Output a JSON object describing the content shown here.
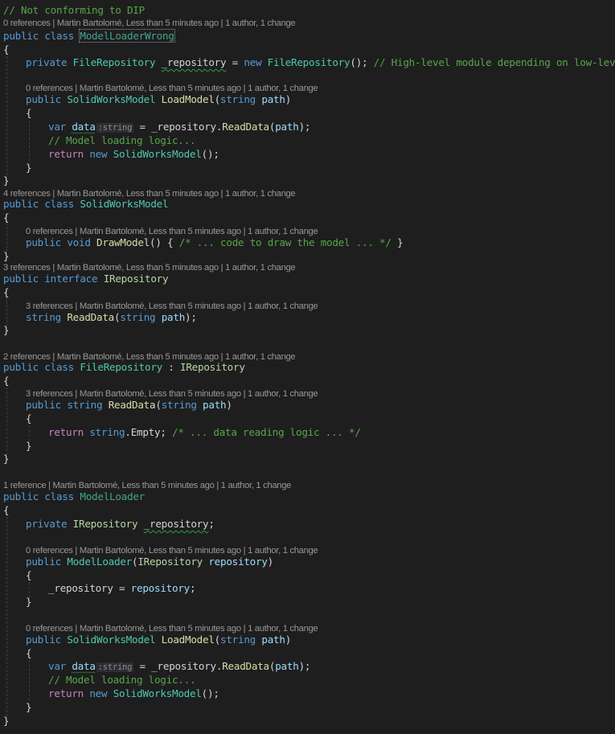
{
  "editor": {
    "comment_header": "// Not conforming to DIP",
    "codelens": {
      "author_info": "Martin Bartolomé, Less than 5 minutes ago",
      "change_info": "1 author, 1 change",
      "ref0": "0 references",
      "ref1": "1 reference",
      "ref2": "2 references",
      "ref3": "3 references",
      "ref4": "4 references",
      "sep": " | "
    },
    "tokens": {
      "public": "public",
      "class": "class",
      "private": "private",
      "new": "new",
      "var": "var",
      "return": "return",
      "void": "void",
      "interface": "interface",
      "string_kw": "string",
      "open_brace": "{",
      "close_brace": "}",
      "colon": " : ",
      "hint_string": ":string"
    },
    "names": {
      "ModelLoaderWrong": "ModelLoaderWrong",
      "FileRepository": "FileRepository",
      "_repository": "_repository",
      "repository": "repository",
      "SolidWorksModel": "SolidWorksModel",
      "LoadModel": "LoadModel",
      "path": "path",
      "data": "data",
      "ReadData": "ReadData",
      "DrawModel": "DrawModel",
      "IRepository": "IRepository",
      "Empty": "Empty",
      "ModelLoader": "ModelLoader"
    },
    "comments": {
      "high_level": "// High-level module depending on low-level",
      "model_loading": "// Model loading logic...",
      "draw_model": "/* ... code to draw the model ... */",
      "data_reading": "/* ... data reading logic ... */"
    },
    "colors": {
      "background": "#1e1e1e",
      "keyword": "#569cd6",
      "control": "#c586c0",
      "type": "#4ec9b0",
      "interface": "#b8d7a3",
      "method": "#dcdcaa",
      "parameter": "#9cdcfe",
      "comment": "#57a64a",
      "codelens": "#999999"
    }
  }
}
